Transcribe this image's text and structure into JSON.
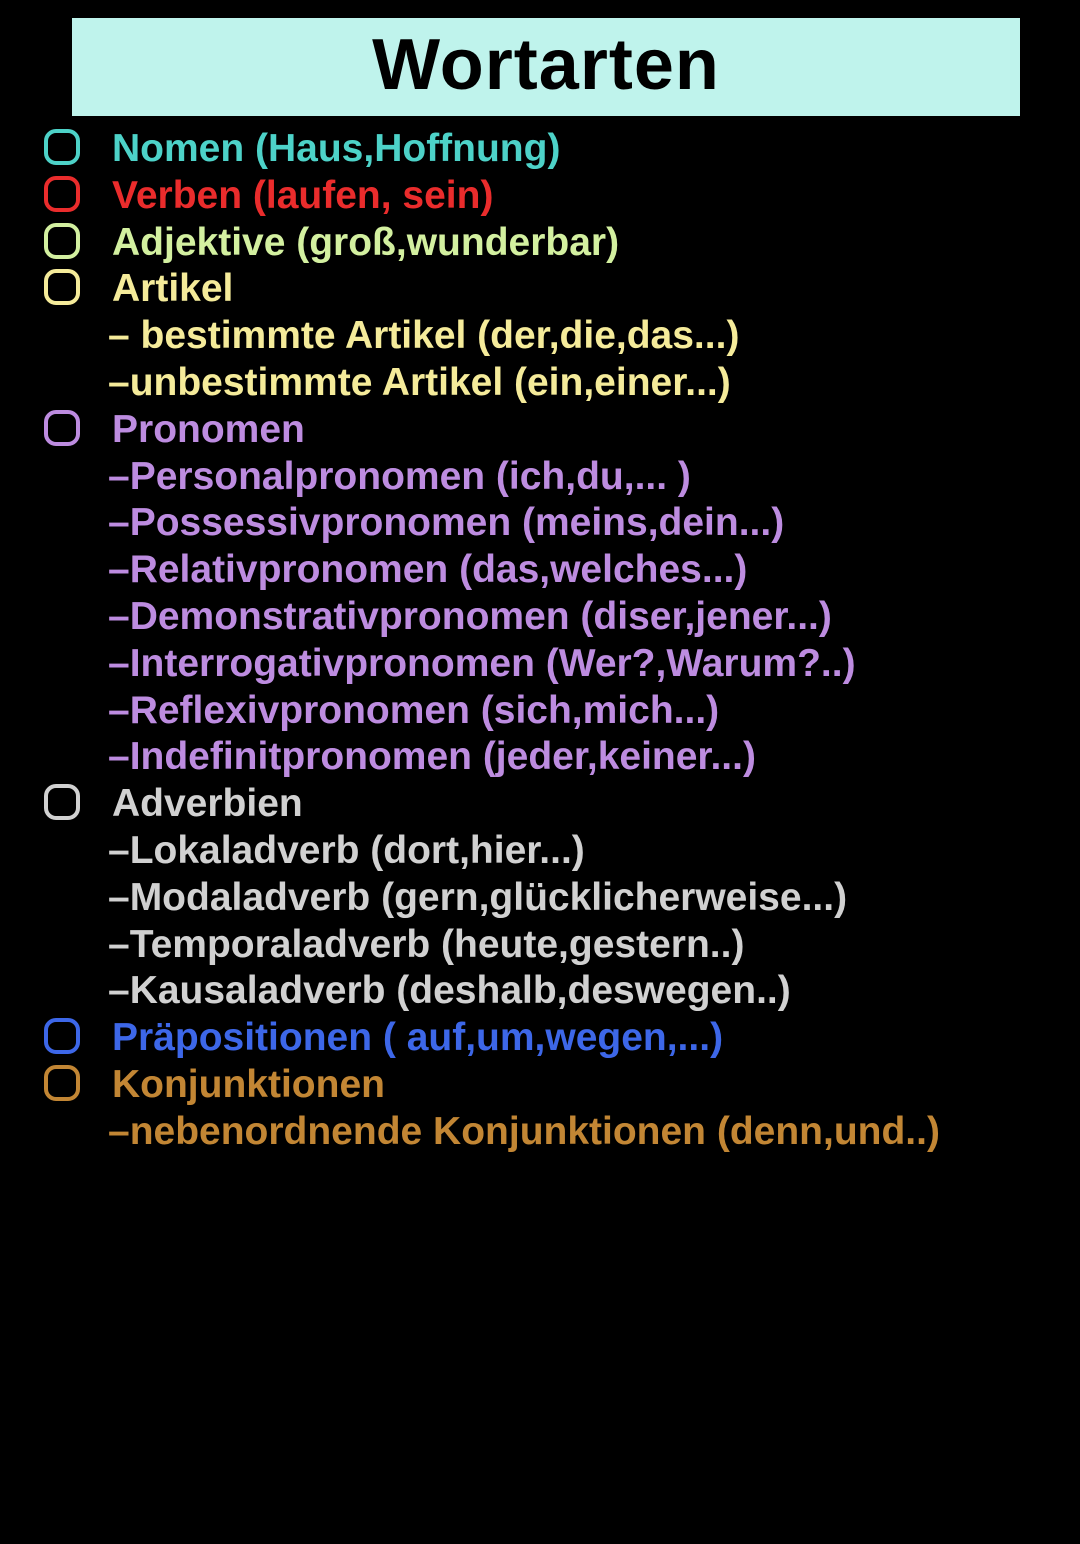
{
  "title": "Wortarten",
  "items": [
    {
      "color": "teal",
      "label": "Nomen (Haus,Hoffnung)",
      "subs": []
    },
    {
      "color": "red",
      "label": "Verben (laufen, sein)",
      "subs": []
    },
    {
      "color": "lime",
      "label": "Adjektive (groß,wunderbar)",
      "subs": []
    },
    {
      "color": "yellow",
      "label": "Artikel",
      "subs": [
        "– bestimmte Artikel (der,die,das...)",
        "–unbestimmte Artikel (ein,einer...)"
      ]
    },
    {
      "color": "purple",
      "label": "Pronomen",
      "subs": [
        "–Personalpronomen (ich,du,... )",
        "–Possessivpronomen (meins,dein...)",
        "–Relativpronomen (das,welches...)",
        "–Demonstrativpronomen (diser,jener...)",
        "–Interrogativpronomen (Wer?,Warum?..)",
        "–Reflexivpronomen (sich,mich...)",
        "–Indefinitpronomen (jeder,keiner...)"
      ]
    },
    {
      "color": "grey",
      "label": "Adverbien",
      "subs": [
        "–Lokaladverb (dort,hier...)",
        "–Modaladverb (gern,glücklicherweise...)",
        "–Temporaladverb (heute,gestern..)",
        "–Kausaladverb (deshalb,deswegen..)"
      ]
    },
    {
      "color": "blue",
      "label": "Präpositionen ( auf,um,wegen,...)",
      "subs": []
    },
    {
      "color": "brown",
      "label": "Konjunktionen",
      "subs": [
        "–nebenordnende Konjunktionen (denn,und..)"
      ]
    }
  ]
}
